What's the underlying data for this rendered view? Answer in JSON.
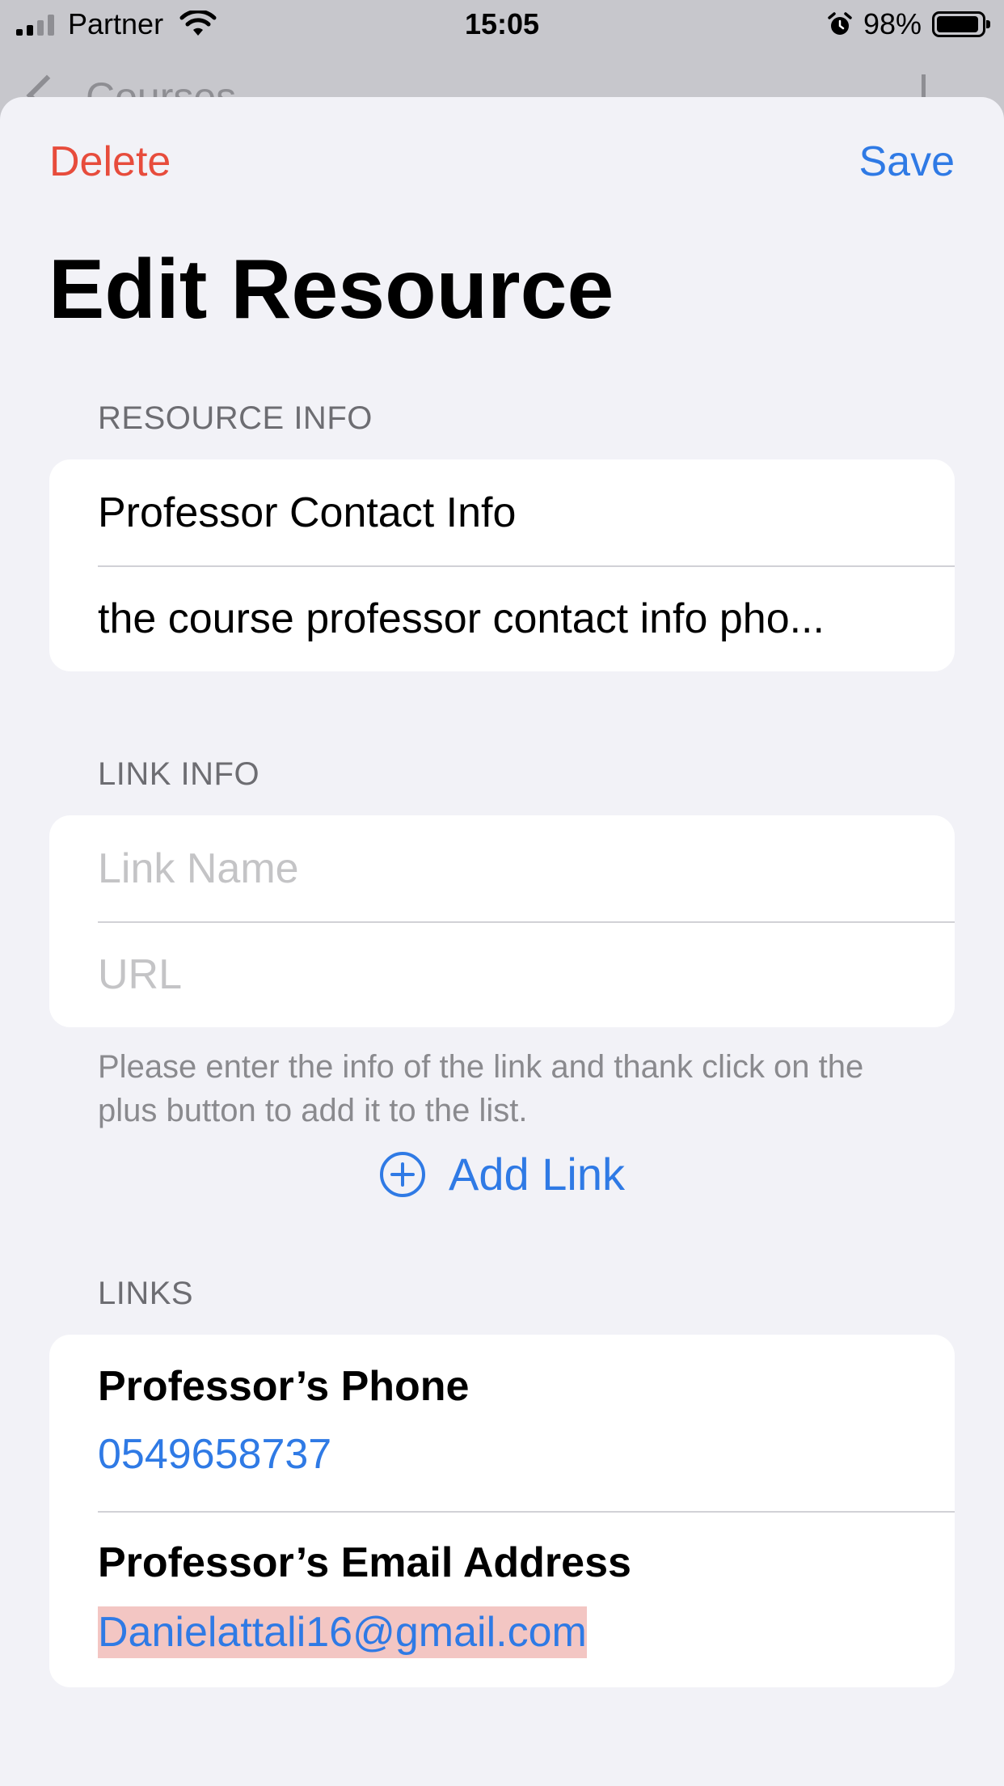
{
  "status_bar": {
    "carrier": "Partner",
    "time": "15:05",
    "battery_percent": "98%"
  },
  "background_nav": {
    "title": "Courses"
  },
  "sheet": {
    "delete_label": "Delete",
    "save_label": "Save",
    "title": "Edit Resource"
  },
  "resource_info": {
    "header": "RESOURCE INFO",
    "name": "Professor Contact Info",
    "description": "the course professor contact info pho..."
  },
  "link_info": {
    "header": "LINK INFO",
    "name_placeholder": "Link Name",
    "url_placeholder": "URL",
    "footer": "Please enter the info of the link and thank click on the plus button to add it to the list.",
    "add_label": "Add Link"
  },
  "links": {
    "header": "LINKS",
    "items": [
      {
        "title": "Professor’s Phone",
        "url": "0549658737"
      },
      {
        "title": "Professor’s Email Address",
        "url": "Danielattali16@gmail.com"
      }
    ]
  },
  "colors": {
    "accent": "#2f7ae5",
    "destructive": "#e74c3c",
    "highlight": "#f3c6c3"
  },
  "icons": [
    "signal-icon",
    "wifi-icon",
    "alarm-icon",
    "battery-icon",
    "chevron-left-icon",
    "plus-circle-icon"
  ]
}
